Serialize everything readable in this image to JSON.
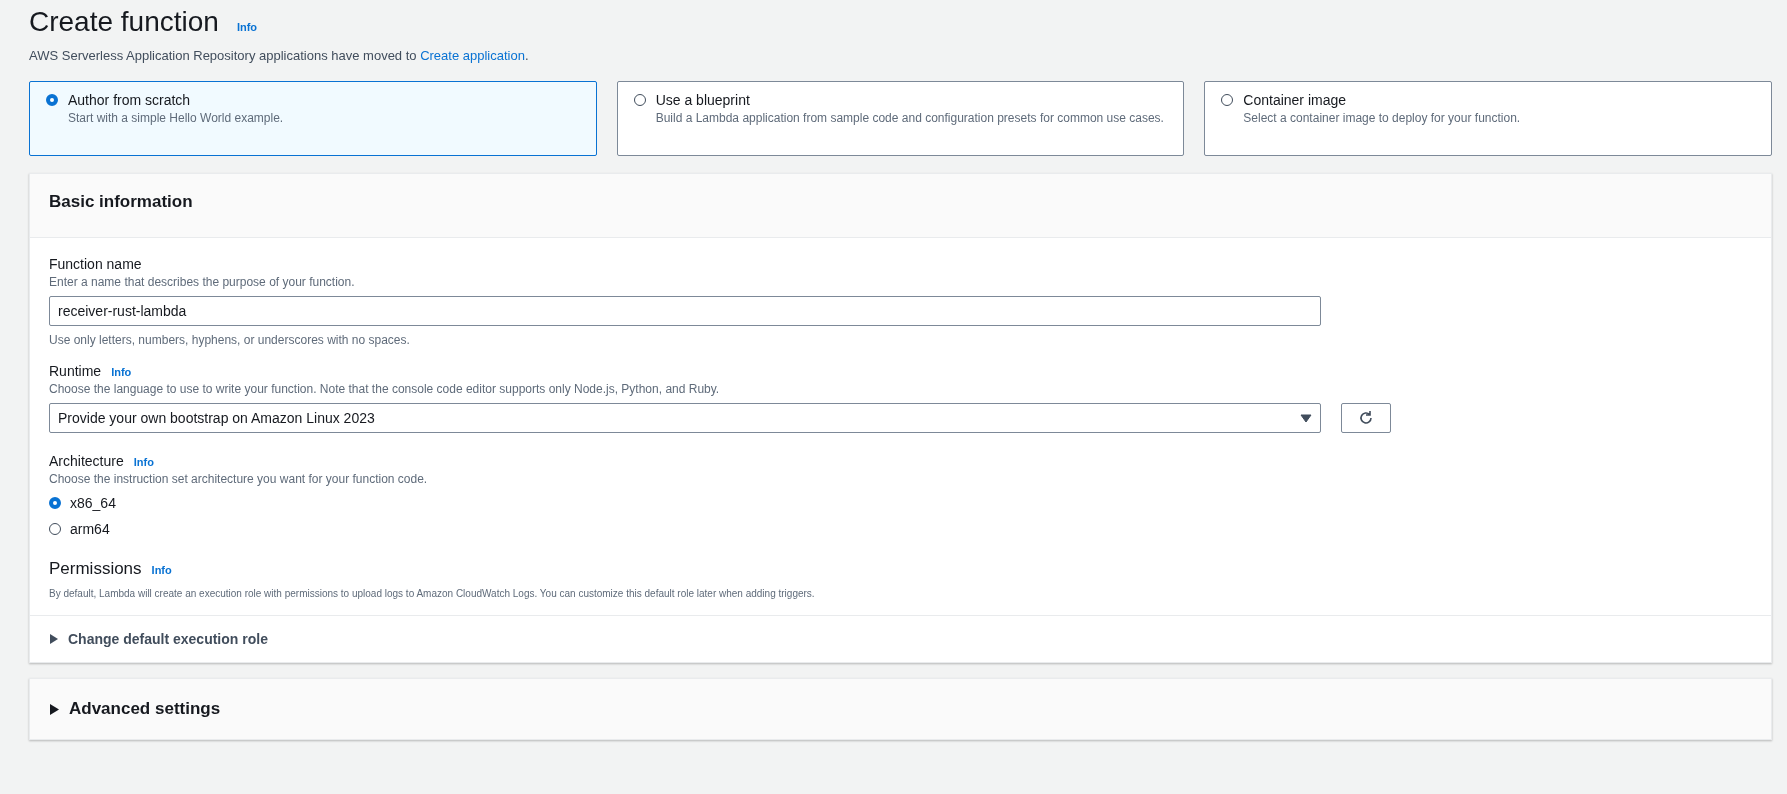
{
  "header": {
    "title": "Create function",
    "info": "Info",
    "notice": "AWS Serverless Application Repository applications have moved to ",
    "notice_link": "Create application",
    "notice_end": "."
  },
  "options": [
    {
      "title": "Author from scratch",
      "description": "Start with a simple Hello World example.",
      "selected": true
    },
    {
      "title": "Use a blueprint",
      "description": "Build a Lambda application from sample code and configuration presets for common use cases.",
      "selected": false
    },
    {
      "title": "Container image",
      "description": "Select a container image to deploy for your function.",
      "selected": false
    }
  ],
  "basic_information": {
    "title": "Basic information",
    "function_name": {
      "label": "Function name",
      "description": "Enter a name that describes the purpose of your function.",
      "value": "receiver-rust-lambda",
      "constraint": "Use only letters, numbers, hyphens, or underscores with no spaces."
    },
    "runtime": {
      "label": "Runtime",
      "info": "Info",
      "description": "Choose the language to use to write your function. Note that the console code editor supports only Node.js, Python, and Ruby.",
      "value": "Provide your own bootstrap on Amazon Linux 2023"
    },
    "architecture": {
      "label": "Architecture",
      "info": "Info",
      "description": "Choose the instruction set architecture you want for your function code.",
      "options": [
        {
          "label": "x86_64",
          "selected": true
        },
        {
          "label": "arm64",
          "selected": false
        }
      ]
    },
    "permissions": {
      "label": "Permissions",
      "info": "Info",
      "description": "By default, Lambda will create an execution role with permissions to upload logs to Amazon CloudWatch Logs. You can customize this default role later when adding triggers."
    },
    "execution_role": {
      "label": "Change default execution role",
      "expanded": false
    }
  },
  "advanced_settings": {
    "label": "Advanced settings",
    "expanded": false
  }
}
